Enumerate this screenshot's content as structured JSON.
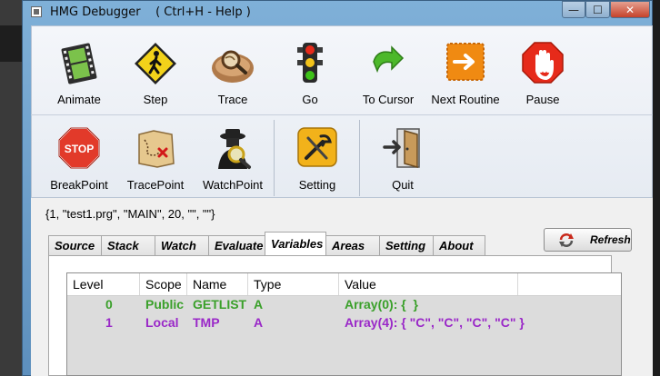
{
  "window": {
    "title": "HMG Debugger    ( Ctrl+H - Help )",
    "min_symbol": "—",
    "max_symbol": "☐",
    "close_symbol": "✕"
  },
  "toolbar": {
    "row1": [
      {
        "label": "Animate",
        "icon": "film-icon"
      },
      {
        "label": "Step",
        "icon": "walking-sign-icon"
      },
      {
        "label": "Trace",
        "icon": "magnifier-rock-icon"
      },
      {
        "label": "Go",
        "icon": "traffic-light-icon"
      },
      {
        "label": "To Cursor",
        "icon": "green-arrow-icon"
      },
      {
        "label": "Next Routine",
        "icon": "orange-arrow-icon"
      },
      {
        "label": "Pause",
        "icon": "stop-hand-icon"
      }
    ],
    "row2": [
      {
        "label": "BreakPoint",
        "icon": "stop-sign-icon"
      },
      {
        "label": "TracePoint",
        "icon": "treasure-map-icon"
      },
      {
        "label": "WatchPoint",
        "icon": "spy-icon"
      },
      {
        "label": "Setting",
        "icon": "tools-icon"
      },
      {
        "label": "Quit",
        "icon": "exit-door-icon"
      }
    ]
  },
  "status": {
    "text": "{1, \"test1.prg\", \"MAIN\", 20, \"\", \"\"}"
  },
  "tabs": [
    {
      "label": "Source",
      "active": false
    },
    {
      "label": "Stack",
      "active": false
    },
    {
      "label": "Watch",
      "active": false
    },
    {
      "label": "Evaluate",
      "active": false
    },
    {
      "label": "Variables",
      "active": true
    },
    {
      "label": "Areas",
      "active": false
    },
    {
      "label": "Setting",
      "active": false
    },
    {
      "label": "About",
      "active": false
    }
  ],
  "refresh": {
    "label": "Refresh"
  },
  "variables": {
    "columns": [
      "Level",
      "Scope",
      "Name",
      "Type",
      "Value"
    ],
    "rows": [
      {
        "level": "0",
        "scope": "Public",
        "name": "GETLIST",
        "type": "A",
        "value": "Array(0): {  }",
        "color": "#3aa02a"
      },
      {
        "level": "1",
        "scope": "Local",
        "name": "TMP",
        "type": "A",
        "value": "Array(4): { \"C\", \"C\", \"C\", \"C\" }",
        "color": "#9a28c8"
      }
    ]
  }
}
